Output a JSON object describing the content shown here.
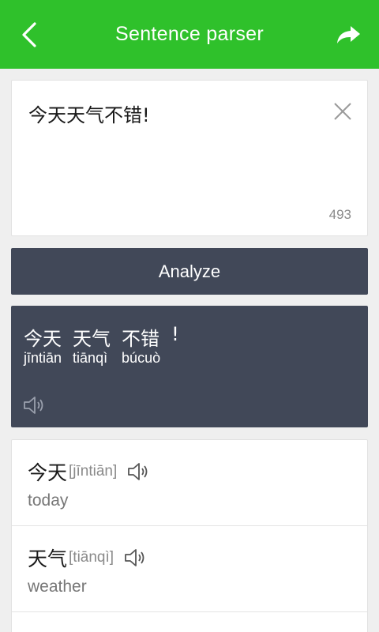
{
  "header": {
    "title": "Sentence parser",
    "back_icon": "chevron-left-icon",
    "share_icon": "share-arrow-icon",
    "color": "#2fc12b"
  },
  "input": {
    "text": "今天天气不错!",
    "char_count": "493",
    "clear_icon": "close-icon"
  },
  "analyze_label": "Analyze",
  "result": {
    "segments": [
      {
        "hanzi": "今天",
        "pinyin": "jīntiān"
      },
      {
        "hanzi": "天气",
        "pinyin": "tiānqì"
      },
      {
        "hanzi": "不错",
        "pinyin": "búcuò"
      },
      {
        "hanzi": "!",
        "pinyin": ""
      }
    ],
    "speaker_icon": "speaker-icon"
  },
  "words": [
    {
      "hanzi": "今天",
      "pinyin": "[jīntiān]",
      "meaning": "today"
    },
    {
      "hanzi": "天气",
      "pinyin": "[tiānqì]",
      "meaning": "weather"
    }
  ]
}
